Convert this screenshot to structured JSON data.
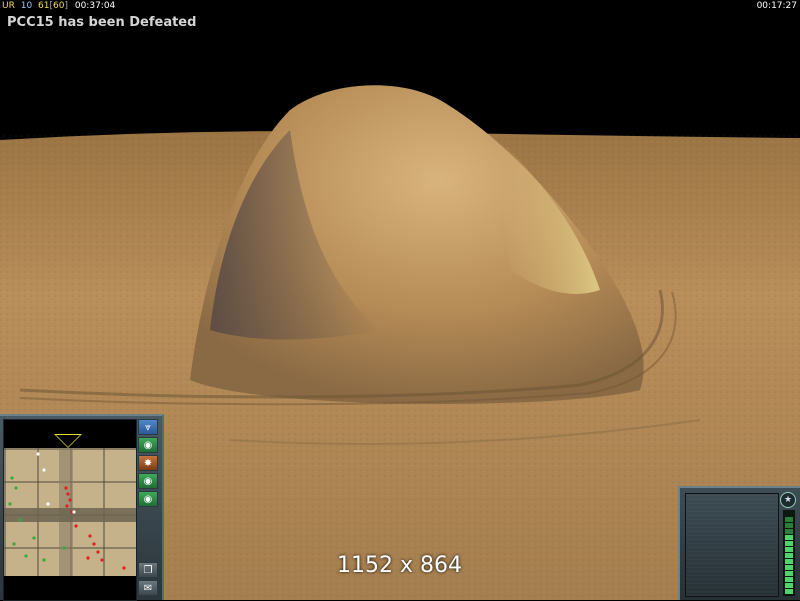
{
  "hud": {
    "faction": "UR",
    "unit_count": "10",
    "supply": "61",
    "supply_cap_open": "[",
    "supply_cap_value": "60",
    "supply_cap_close": "]",
    "game_time": "00:37:04",
    "clock": "00:17:27"
  },
  "message": "PCC15 has been Defeated",
  "overlay": {
    "resolution": "1152 x 864"
  },
  "minimap": {
    "buttons": [
      {
        "icon": "rank-chevron-icon",
        "glyph": "⩔",
        "color": "#4f86c8"
      },
      {
        "icon": "radar-icon",
        "glyph": "◉",
        "color": "#3fa85a"
      },
      {
        "icon": "danger-icon",
        "glyph": "✸",
        "color": "#c8743a"
      },
      {
        "icon": "radar-icon",
        "glyph": "◉",
        "color": "#3fa85a"
      },
      {
        "icon": "radar-icon",
        "glyph": "◉",
        "color": "#3fa85a"
      }
    ],
    "bottom_buttons": [
      {
        "icon": "window-icon",
        "glyph": "❐"
      },
      {
        "icon": "chat-icon",
        "glyph": "✉"
      }
    ],
    "colors": {
      "enemy": "#e02020",
      "ally": "#3aa83a",
      "neutral": "#ffffff"
    }
  },
  "panel": {
    "emblem_icon": "star-emblem-icon",
    "emblem_glyph": "★",
    "meter_level": 0.75
  },
  "colors": {
    "sand": "#c2955a",
    "sky": "#000000",
    "hud_frame": "#4a5a62"
  }
}
